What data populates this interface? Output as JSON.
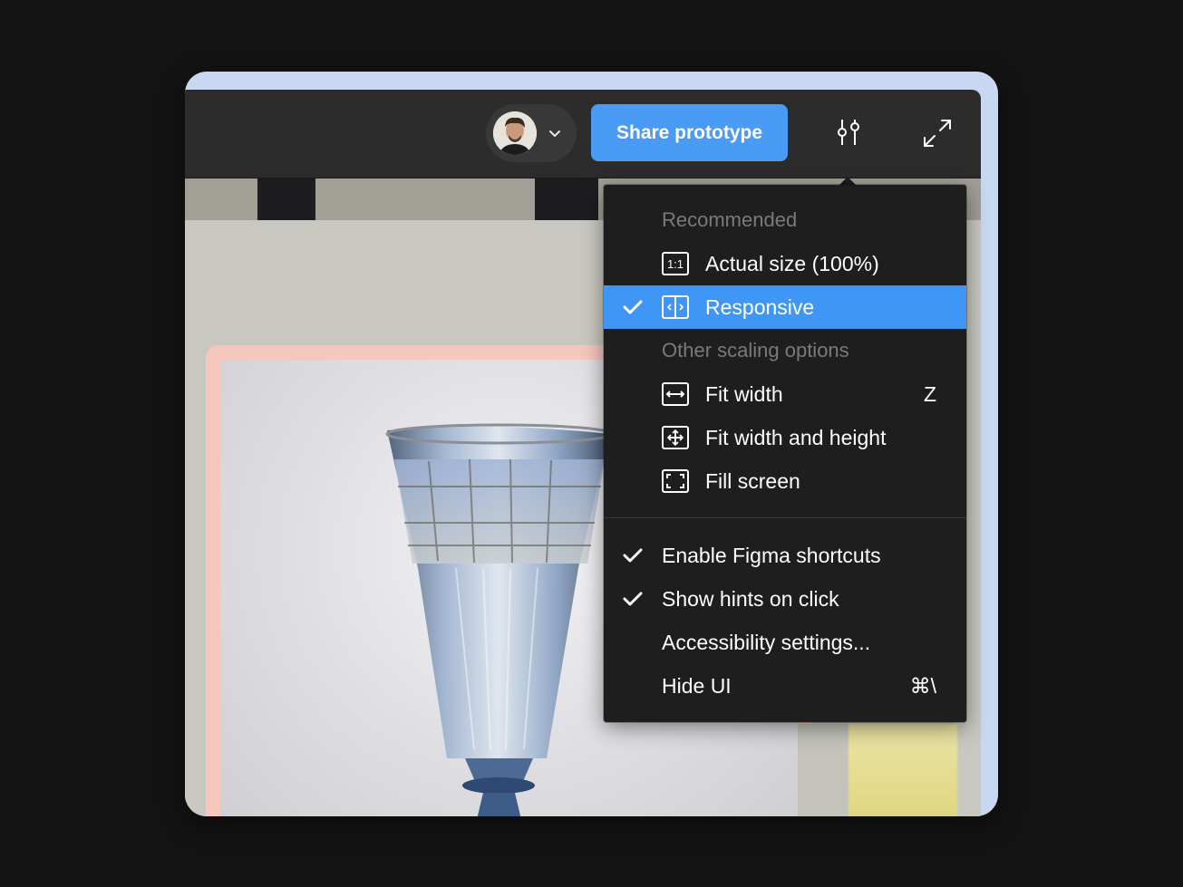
{
  "toolbar": {
    "share_label": "Share prototype",
    "accent_color": "#4a9bf5"
  },
  "menu": {
    "recommended_heading": "Recommended",
    "actual_size_label": "Actual size (100%)",
    "responsive_label": "Responsive",
    "other_heading": "Other scaling options",
    "fit_width_label": "Fit width",
    "fit_width_shortcut": "Z",
    "fit_width_height_label": "Fit width and height",
    "fill_screen_label": "Fill screen",
    "enable_shortcuts_label": "Enable Figma shortcuts",
    "show_hints_label": "Show hints on click",
    "accessibility_label": "Accessibility settings...",
    "hide_ui_label": "Hide UI",
    "hide_ui_shortcut": "⌘\\",
    "selected_color": "#3f96f4"
  },
  "icons": {
    "actual_size": "actual-size-icon",
    "responsive": "responsive-icon",
    "fit_width": "fit-width-icon",
    "fit_width_height": "fit-width-height-icon",
    "fill_screen": "fill-screen-icon",
    "settings": "sliders-icon",
    "expand": "expand-icon"
  }
}
